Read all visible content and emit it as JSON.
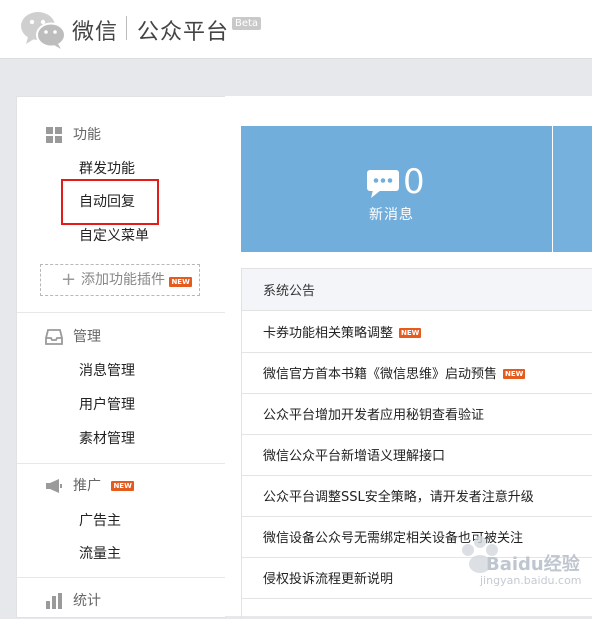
{
  "header": {
    "brand": "微信",
    "platform": "公众平台",
    "beta": "Beta"
  },
  "sidebar": {
    "sections": [
      {
        "title": "功能",
        "icon": "grid-icon",
        "items": [
          "群发功能",
          "自动回复",
          "自定义菜单"
        ]
      },
      {
        "title": "管理",
        "icon": "inbox-icon",
        "items": [
          "消息管理",
          "用户管理",
          "素材管理"
        ]
      },
      {
        "title": "推广",
        "icon": "megaphone-icon",
        "badge": "NEW",
        "items": [
          "广告主",
          "流量主"
        ]
      },
      {
        "title": "统计",
        "icon": "chart-icon",
        "items": []
      }
    ],
    "add_plugin": "添加功能插件",
    "add_plugin_badge": "NEW"
  },
  "main": {
    "stat": {
      "value": "0",
      "label": "新消息"
    },
    "notices": {
      "title": "系统公告",
      "items": [
        {
          "text": "卡券功能相关策略调整",
          "badge": "NEW"
        },
        {
          "text": "微信官方首本书籍《微信思维》启动预售",
          "badge": "NEW"
        },
        {
          "text": "公众平台增加开发者应用秘钥查看验证"
        },
        {
          "text": "微信公众平台新增语义理解接口"
        },
        {
          "text": "公众平台调整SSL安全策略，请开发者注意升级"
        },
        {
          "text": "微信设备公众号无需绑定相关设备也可被关注"
        },
        {
          "text": "侵权投诉流程更新说明"
        }
      ]
    }
  },
  "watermark": {
    "text": "Baidu经验",
    "sub": "jingyan.baidu.com"
  },
  "colors": {
    "stat_card": "#72aedb",
    "highlight": "#e21b1b",
    "new_badge": "#e55b1e"
  }
}
